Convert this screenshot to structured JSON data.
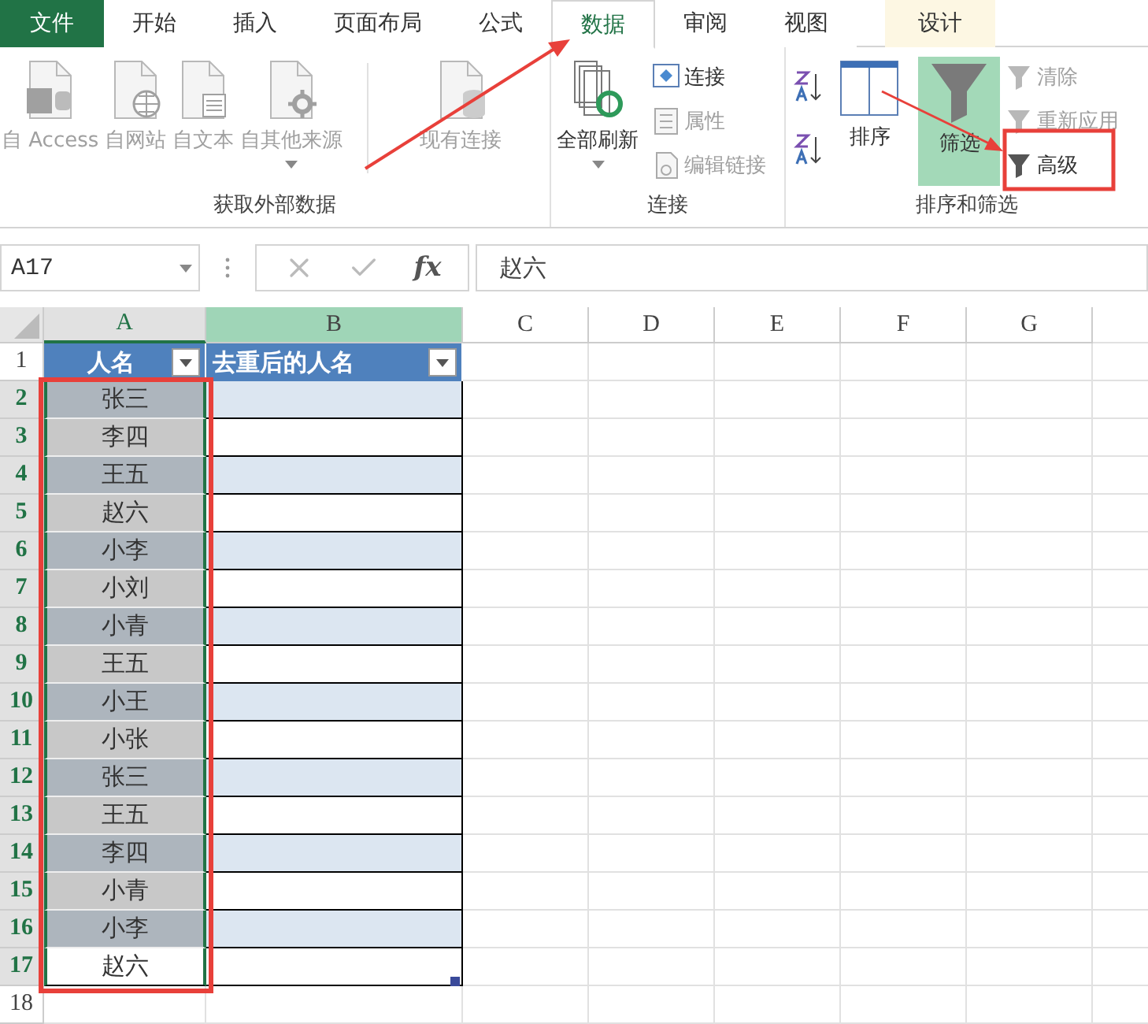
{
  "tabs": [
    {
      "label": "文件",
      "kind": "file",
      "selected": false
    },
    {
      "label": "开始",
      "kind": "normal",
      "selected": false
    },
    {
      "label": "插入",
      "kind": "normal",
      "selected": false
    },
    {
      "label": "页面布局",
      "kind": "normal",
      "selected": false
    },
    {
      "label": "公式",
      "kind": "normal",
      "selected": false
    },
    {
      "label": "数据",
      "kind": "normal",
      "selected": true
    },
    {
      "label": "审阅",
      "kind": "normal",
      "selected": false
    },
    {
      "label": "视图",
      "kind": "normal",
      "selected": false
    },
    {
      "label": "设计",
      "kind": "contextual",
      "selected": false
    }
  ],
  "ribbon_groups": [
    {
      "label": "获取外部数据",
      "buttons": [
        {
          "label": "自 Access",
          "disabled": true
        },
        {
          "label": "自网站",
          "disabled": true
        },
        {
          "label": "自文本",
          "disabled": true
        },
        {
          "label": "自其他来源",
          "disabled": true
        },
        {
          "label": "现有连接",
          "disabled": true
        }
      ]
    },
    {
      "label": "连接",
      "buttons": [
        {
          "label": "全部刷新",
          "disabled": false
        },
        {
          "label": "连接",
          "disabled": false
        },
        {
          "label": "属性",
          "disabled": true
        },
        {
          "label": "编辑链接",
          "disabled": true
        }
      ]
    },
    {
      "label": "排序和筛选",
      "buttons": [
        {
          "label": "排序",
          "disabled": false
        },
        {
          "label": "筛选",
          "disabled": false,
          "on": true
        },
        {
          "label": "清除",
          "disabled": true
        },
        {
          "label": "重新应用",
          "disabled": true
        },
        {
          "label": "高级",
          "disabled": false
        }
      ]
    }
  ],
  "formula_bar": {
    "name_box": "A17",
    "fx": "fx",
    "value": "赵六"
  },
  "columns": [
    {
      "label": "A",
      "selected": true,
      "highlighted": false
    },
    {
      "label": "B",
      "selected": false,
      "highlighted": true
    },
    {
      "label": "C",
      "selected": false,
      "highlighted": false
    },
    {
      "label": "D",
      "selected": false,
      "highlighted": false
    },
    {
      "label": "E",
      "selected": false,
      "highlighted": false
    },
    {
      "label": "F",
      "selected": false,
      "highlighted": false
    },
    {
      "label": "G",
      "selected": false,
      "highlighted": false
    }
  ],
  "row_headers": [
    {
      "label": "1",
      "selected": false
    },
    {
      "label": "2",
      "selected": true
    },
    {
      "label": "3",
      "selected": true
    },
    {
      "label": "4",
      "selected": true
    },
    {
      "label": "5",
      "selected": true
    },
    {
      "label": "6",
      "selected": true
    },
    {
      "label": "7",
      "selected": true
    },
    {
      "label": "8",
      "selected": true
    },
    {
      "label": "9",
      "selected": true
    },
    {
      "label": "10",
      "selected": true
    },
    {
      "label": "11",
      "selected": true
    },
    {
      "label": "12",
      "selected": true
    },
    {
      "label": "13",
      "selected": true
    },
    {
      "label": "14",
      "selected": true
    },
    {
      "label": "15",
      "selected": true
    },
    {
      "label": "16",
      "selected": true
    },
    {
      "label": "17",
      "selected": true
    },
    {
      "label": "18",
      "selected": false
    }
  ],
  "table": {
    "headers": [
      "人名",
      "去重后的人名"
    ],
    "cells": [
      {
        "name": "张三",
        "banded": true,
        "selected": true,
        "active": false
      },
      {
        "name": "李四",
        "banded": false,
        "selected": true,
        "active": false
      },
      {
        "name": "王五",
        "banded": true,
        "selected": true,
        "active": false
      },
      {
        "name": "赵六",
        "banded": false,
        "selected": true,
        "active": false
      },
      {
        "name": "小李",
        "banded": true,
        "selected": true,
        "active": false
      },
      {
        "name": "小刘",
        "banded": false,
        "selected": true,
        "active": false
      },
      {
        "name": "小青",
        "banded": true,
        "selected": true,
        "active": false
      },
      {
        "name": "王五",
        "banded": false,
        "selected": true,
        "active": false
      },
      {
        "name": "小王",
        "banded": true,
        "selected": true,
        "active": false
      },
      {
        "name": "小张",
        "banded": false,
        "selected": true,
        "active": false
      },
      {
        "name": "张三",
        "banded": true,
        "selected": true,
        "active": false
      },
      {
        "name": "王五",
        "banded": false,
        "selected": true,
        "active": false
      },
      {
        "name": "李四",
        "banded": true,
        "selected": true,
        "active": false
      },
      {
        "name": "小青",
        "banded": false,
        "selected": true,
        "active": false
      },
      {
        "name": "小李",
        "banded": true,
        "selected": true,
        "active": false
      },
      {
        "name": "赵六",
        "banded": false,
        "selected": true,
        "active": true
      }
    ]
  }
}
